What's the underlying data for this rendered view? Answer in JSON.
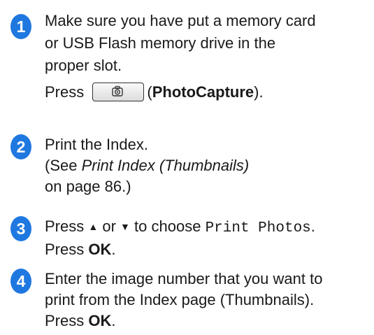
{
  "steps": [
    {
      "number": "1",
      "lines": [
        "Make sure you have put a memory card",
        "or USB Flash memory drive in the",
        "proper slot."
      ],
      "press_prefix": "Press",
      "button_icon": "camera-icon",
      "paren_open": "(",
      "button_name": "PhotoCapture",
      "paren_close": ")."
    },
    {
      "number": "2",
      "line1": "Print the Index.",
      "see_prefix": "(See ",
      "see_link": "Print Index (Thumbnails)",
      "line3": "on page 86.)"
    },
    {
      "number": "3",
      "press": "Press",
      "up_arrow": "▲",
      "or": "or",
      "down_arrow": "▼",
      "to_choose": "to choose",
      "menu_option": "Print Photos",
      "period": ".",
      "press2": "Press",
      "ok": "OK",
      "period2": "."
    },
    {
      "number": "4",
      "line1": "Enter the image number that you want to",
      "line2": "print from the Index page (Thumbnails).",
      "press": "Press",
      "ok": "OK",
      "period": "."
    }
  ],
  "colors": {
    "step_badge": "#1f78e0",
    "text": "#1a1a1a"
  }
}
